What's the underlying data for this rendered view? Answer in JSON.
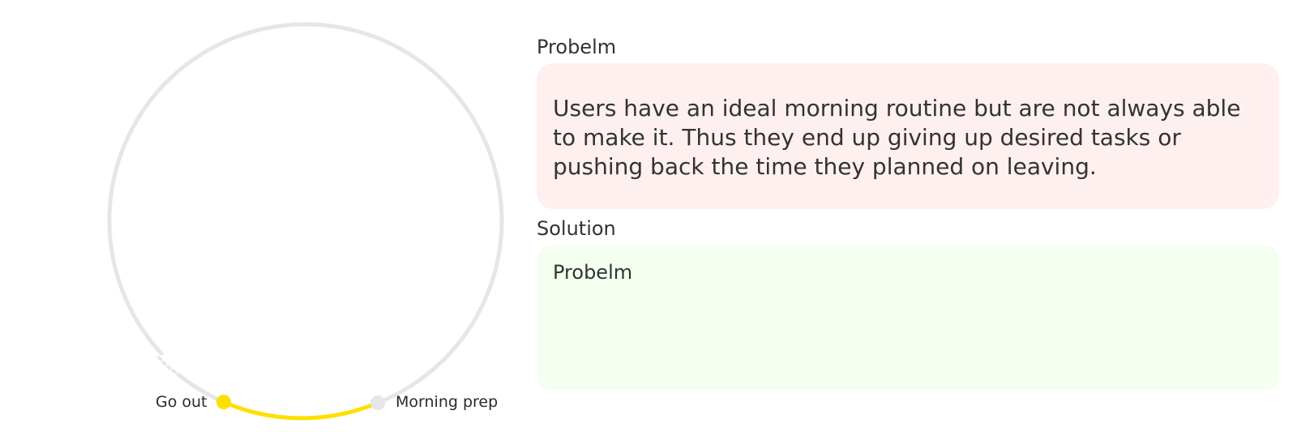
{
  "dial": {
    "start_label": "Go out",
    "end_label": "Morning prep",
    "colors": {
      "track": "#e6e6e6",
      "active_arc": "#fde000",
      "start_knob": "#fde000",
      "end_knob": "#e6e6e6"
    }
  },
  "problem": {
    "heading": "Probelm",
    "body": "Users have an ideal morning routine but are not always able to make it. Thus they end up giving up desired tasks or pushing back the time they planned on leaving.",
    "background": "#fff0f0"
  },
  "solution": {
    "heading": "Solution",
    "body": "Probelm",
    "background": "#f5fff0"
  }
}
